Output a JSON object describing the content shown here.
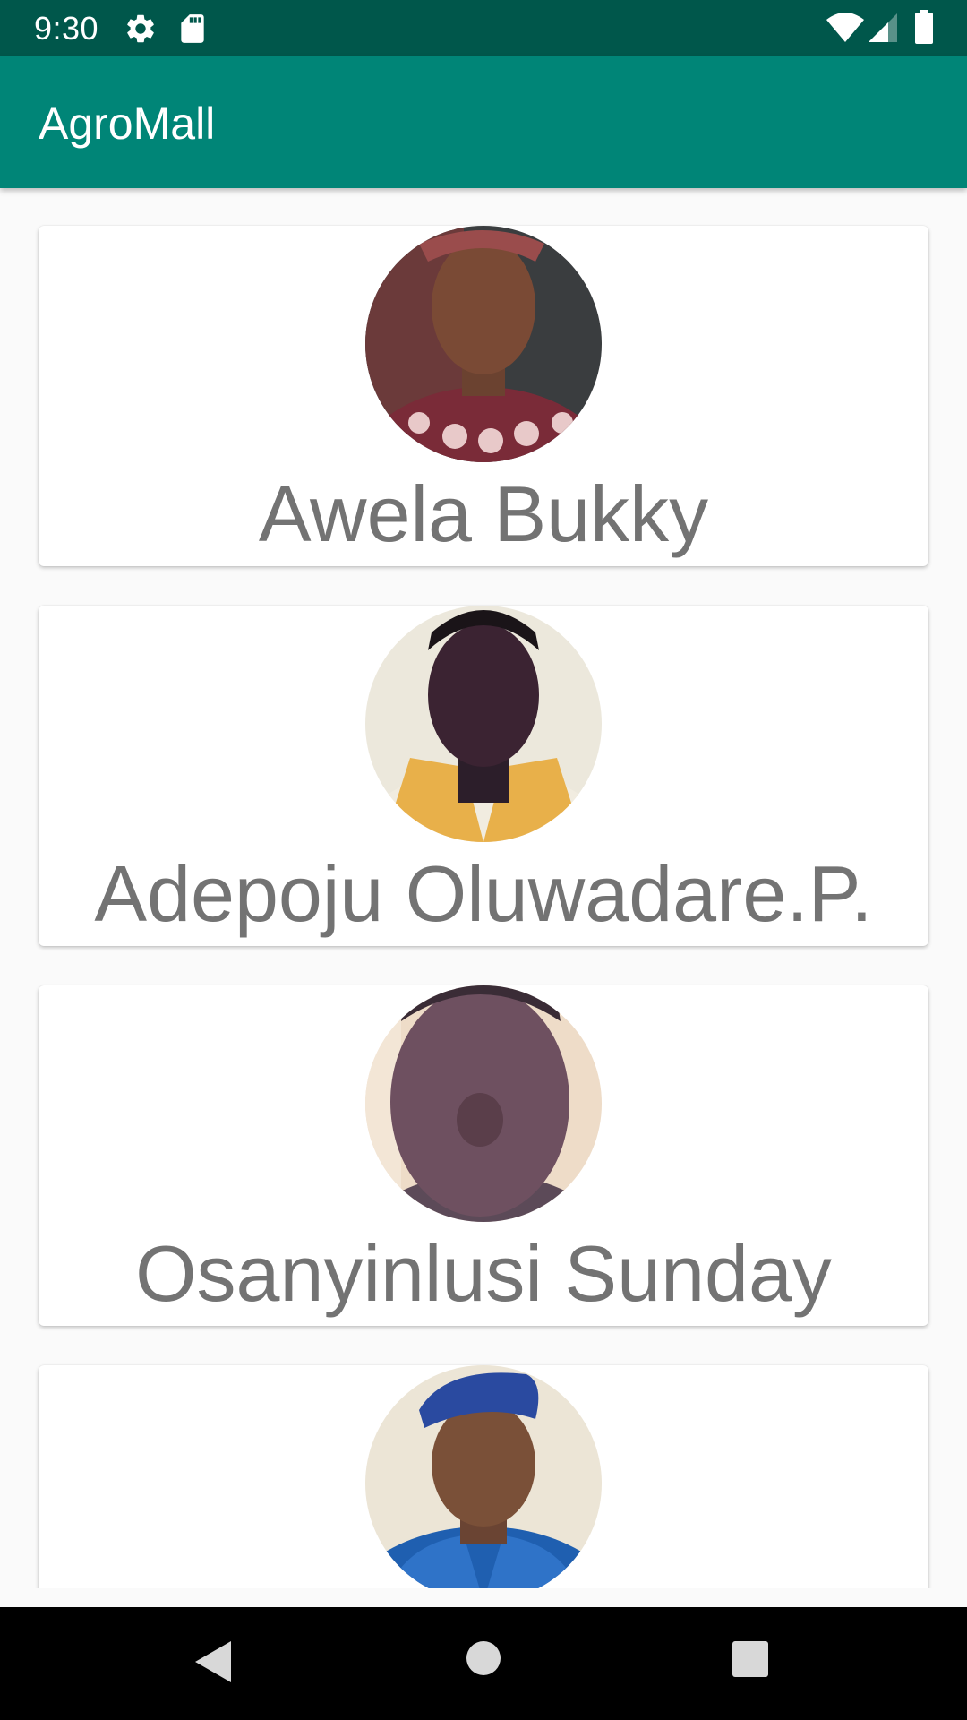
{
  "status_bar": {
    "time": "9:30",
    "icons": [
      "gear-icon",
      "sd-card-icon",
      "wifi-icon",
      "signal-icon",
      "battery-icon"
    ]
  },
  "app_bar": {
    "title": "AgroMall",
    "color": "#008577",
    "status_color": "#00574b"
  },
  "farmers": [
    {
      "name": "Awela Bukky",
      "photo": "avatar-photo"
    },
    {
      "name": "Adepoju Oluwadare.P.",
      "photo": "avatar-photo"
    },
    {
      "name": "Osanyinlusi Sunday",
      "photo": "avatar-photo"
    },
    {
      "name": "",
      "photo": "avatar-photo"
    }
  ],
  "navigation": {
    "icons": [
      "back-icon",
      "home-icon",
      "recents-icon"
    ]
  }
}
